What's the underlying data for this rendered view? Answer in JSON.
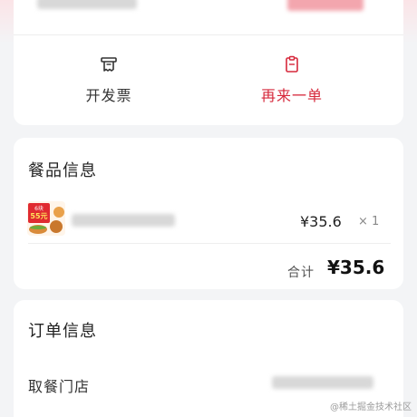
{
  "actions": {
    "invoice_label": "开发票",
    "reorder_label": "再来一单"
  },
  "meal_info": {
    "title": "餐品信息",
    "item": {
      "price": "¥35.6",
      "quantity": "× 1",
      "promo_top": "6块",
      "promo_mid": "55元"
    },
    "total_label": "合计",
    "total_value": "¥35.6"
  },
  "order_info": {
    "title": "订单信息",
    "pickup_store_label": "取餐门店"
  },
  "watermark": "@稀土掘金技术社区",
  "colors": {
    "accent": "#d6283b",
    "background": "#f3f4f6",
    "card": "#ffffff"
  }
}
